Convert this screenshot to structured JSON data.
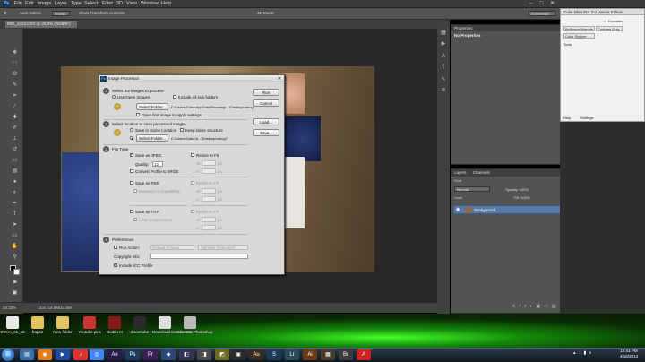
{
  "app": {
    "logo": "Ps"
  },
  "menu": [
    "File",
    "Edit",
    "Image",
    "Layer",
    "Type",
    "Select",
    "Filter",
    "3D",
    "View",
    "Window",
    "Help"
  ],
  "window_controls": [
    "–",
    "□",
    "✕"
  ],
  "options_bar": {
    "auto_select": "Auto-Select:",
    "group": "Group",
    "show_transform": "Show Transform Controls",
    "mode_3d": "3D Mode:",
    "workspace": "Essentials"
  },
  "document_tab": "IMG_2423.CR2 @ 33.3% (RGB/8*)",
  "status": {
    "zoom": "33.33%",
    "doc": "Doc: 14.0M/14.0M"
  },
  "properties_panel": {
    "title": "Properties",
    "content": "No Properties"
  },
  "layers_panel": {
    "tabs": [
      "Layers",
      "Channels"
    ],
    "kind": "Kind",
    "blend": "Normal",
    "opacity": "Opacity: 100%",
    "lock": "Lock:",
    "fill": "Fill: 100%",
    "layer_name": "Background"
  },
  "color_efex": {
    "title": "Color Efex Pro 3.0 Viveza Edition",
    "favorites": "Favorites",
    "filters": [
      "Brilliance/Warmth",
      "Contrast Only",
      "Color Stylizer"
    ],
    "tools": "Tools",
    "footer": [
      "Help",
      "Settings"
    ]
  },
  "dialog": {
    "title": "Image Processor",
    "s1": {
      "heading": "Select the images to process",
      "use_open": "Use Open Images",
      "include_sub": "Include All sub-folders",
      "select_folder": "Select Folder...",
      "path": "C:\\Users\\Gabe\\AppData\\Roaming\\...\\Desktop\\adroy",
      "open_first": "Open first image to apply settings"
    },
    "s2": {
      "heading": "Select location to save processed images",
      "same_location": "Save in Same Location",
      "keep_structure": "Keep folder structure",
      "select_folder": "Select Folder...",
      "path": "C:\\Users\\Gabe\\A...\\Desktop\\adroy2"
    },
    "s3": {
      "heading": "File Type",
      "save_jpeg": "Save as JPEG",
      "resize_fit": "Resize to Fit",
      "quality": "Quality:",
      "quality_value": "12",
      "w": "W:",
      "h": "H:",
      "px": "px",
      "convert_srgb": "Convert Profile to sRGB",
      "save_psd": "Save as PSD",
      "max_compat": "Maximize Compatibility",
      "save_tiff": "Save as TIFF",
      "lzw": "LZW Compression"
    },
    "s4": {
      "heading": "Preferences",
      "run_action": "Run Action:",
      "action_set": "Default Actions",
      "action": "Vignette (selection)",
      "copyright": "Copyright Info:",
      "include_icc": "Include ICC Profile"
    },
    "buttons": [
      "Run",
      "Cancel",
      "Load...",
      "Save..."
    ]
  },
  "desktop_icons": [
    "SVHA_21_12",
    "fraps2",
    "New folder",
    "Youtube pics",
    "Diablo III",
    "Zoomtube",
    "Download Documents",
    "Shortcut Photoshop"
  ],
  "clock": {
    "time": "12:41 PM",
    "date": "4/18/2013"
  },
  "colors": {
    "ps_bg": "#535353",
    "dialog_bg": "#d8d8d8",
    "accent_green": "#46ff2a",
    "layer_highlight": "#5878a5"
  }
}
